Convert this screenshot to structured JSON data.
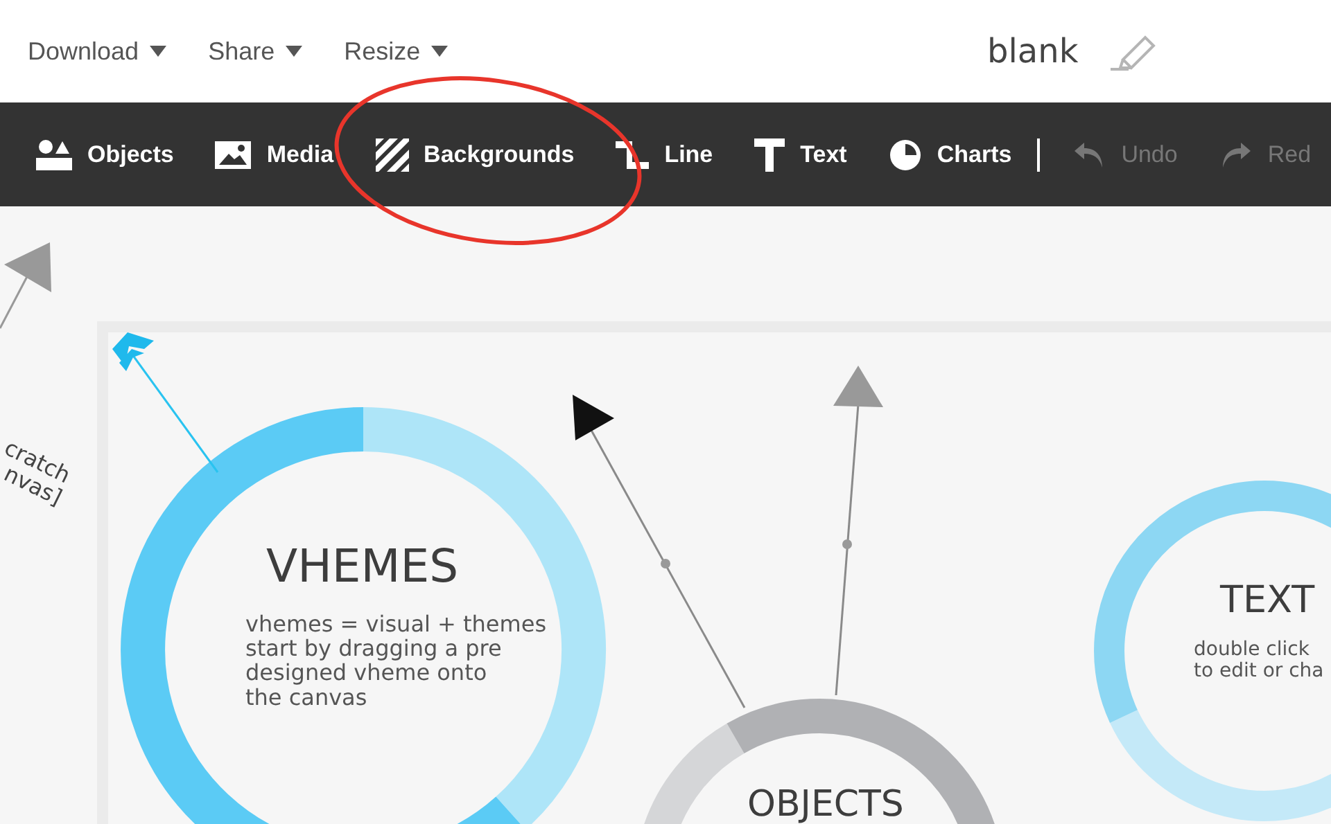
{
  "top_bar": {
    "menus": [
      {
        "label": "Download"
      },
      {
        "label": "Share"
      },
      {
        "label": "Resize"
      }
    ],
    "document_title": "blank"
  },
  "toolbar": {
    "tools": [
      {
        "label": "Objects",
        "disabled": false
      },
      {
        "label": "Media",
        "disabled": false
      },
      {
        "label": "Backgrounds",
        "disabled": false
      },
      {
        "label": "Line",
        "disabled": false
      },
      {
        "label": "Text",
        "disabled": false
      },
      {
        "label": "Charts",
        "disabled": false
      }
    ],
    "history": [
      {
        "label": "Undo",
        "disabled": true
      },
      {
        "label": "Red",
        "disabled": true
      }
    ]
  },
  "canvas": {
    "side_note": [
      "cratch",
      "nvas]"
    ],
    "circles": [
      {
        "title": "VHEMES",
        "body": [
          "vhemes = visual + themes",
          "start by dragging a pre",
          "designed vheme onto",
          "the canvas"
        ]
      },
      {
        "title": "OBJECTS"
      },
      {
        "title": "TEXT",
        "body": [
          "double click",
          "to edit or cha"
        ]
      }
    ]
  }
}
